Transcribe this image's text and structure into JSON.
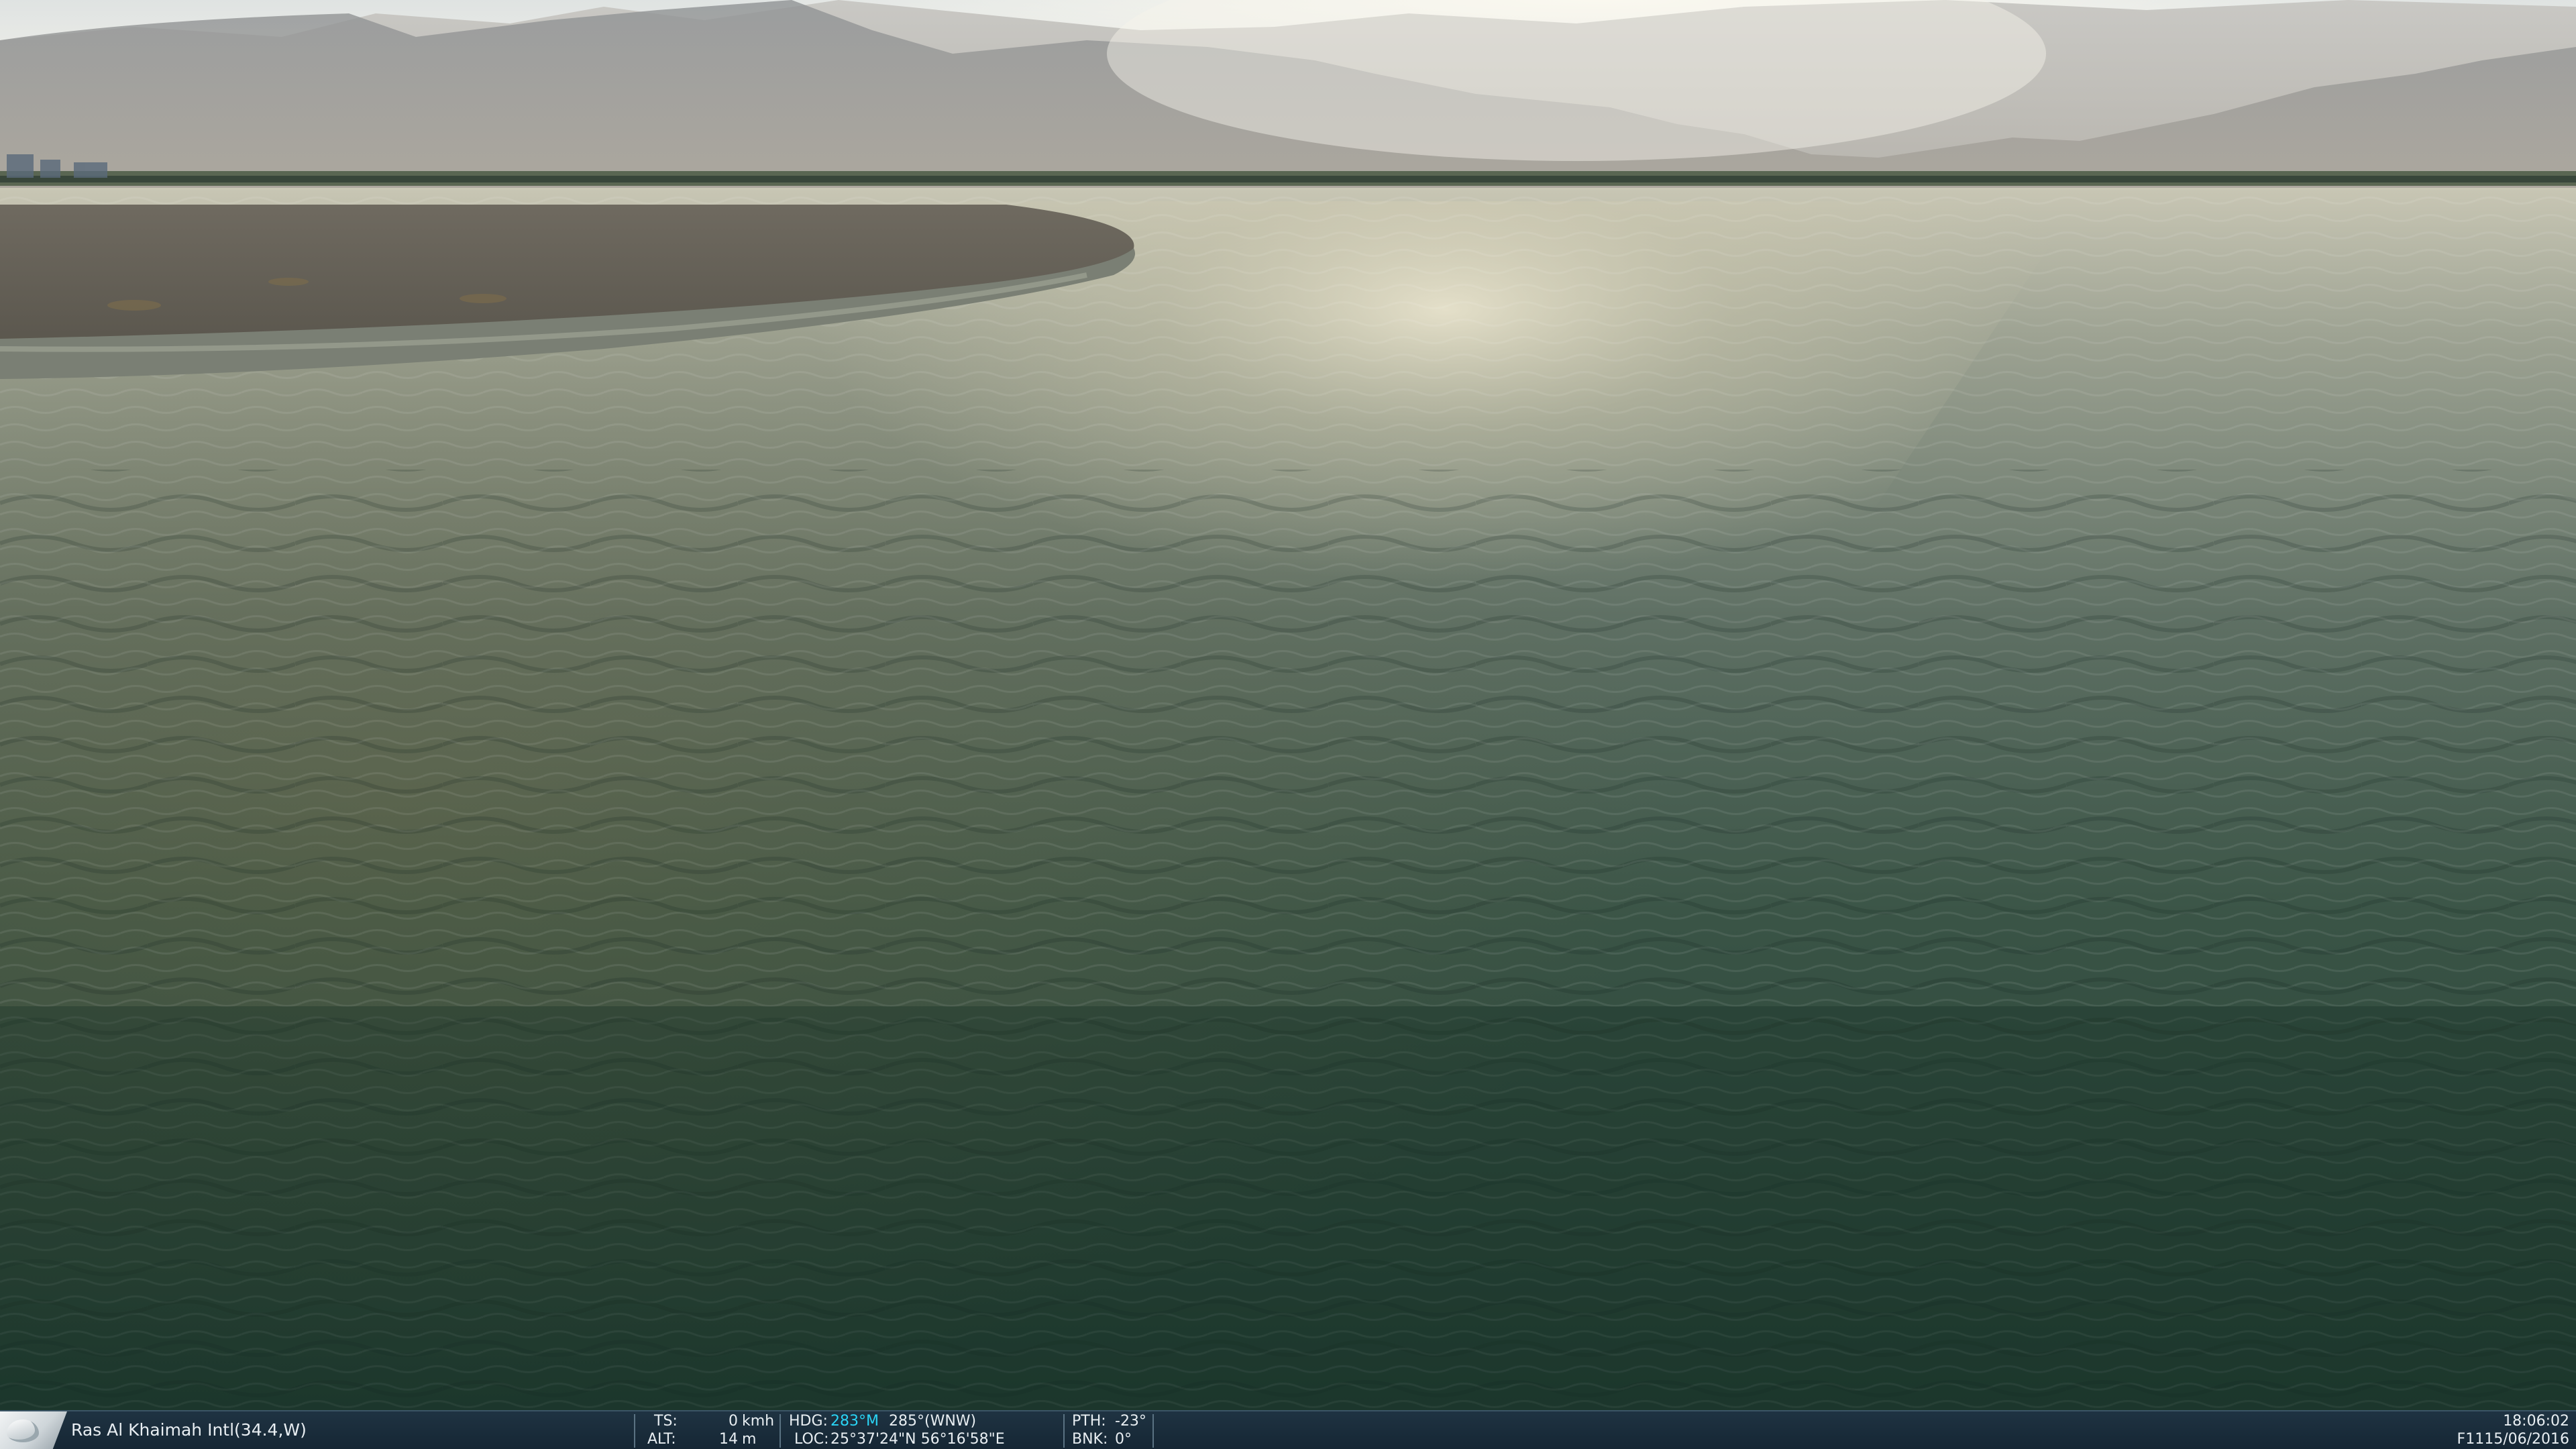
{
  "status_bar": {
    "location": "Ras Al Khaimah Intl(34.4,W)",
    "ts_label": "TS:",
    "ts_value": "0",
    "ts_unit": "kmh",
    "alt_label": "ALT:",
    "alt_value": "14",
    "alt_unit": "m",
    "hdg_label": "HDG:",
    "hdg_magnetic": "283°M",
    "hdg_true": "285°(WNW)",
    "loc_label": "LOC:",
    "loc_value": "25°37'24\"N 56°16'58\"E",
    "pth_label": "PTH:",
    "pth_value": "-23°",
    "bnk_label": "BNK:",
    "bnk_value": "0°",
    "time": "18:06:02",
    "date": "F1115/06/2016"
  },
  "colors": {
    "status_bar_bg": "#1a2d3b",
    "accent_cyan": "#2ad4f5",
    "water_dark": "#1f3a2e",
    "sky": "#e8ebe8"
  },
  "icons": {
    "logo": "sim-logo-icon"
  }
}
